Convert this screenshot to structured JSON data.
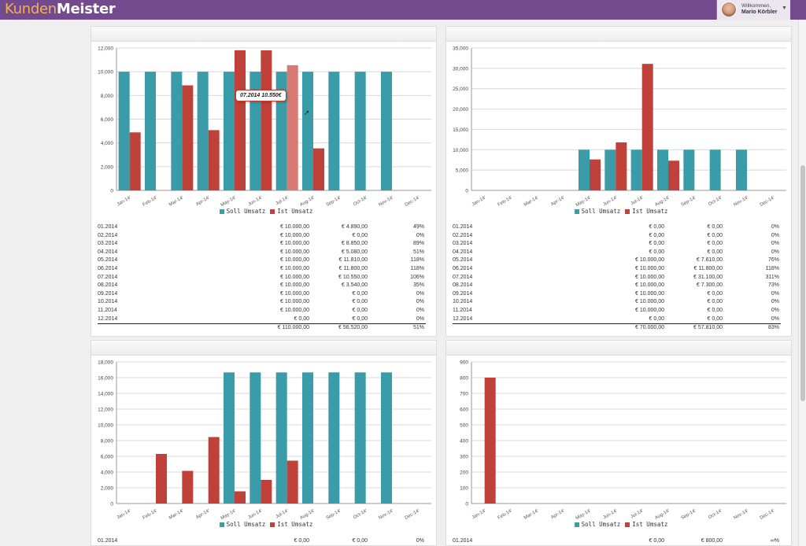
{
  "app": {
    "logo_part1": "Kunden",
    "logo_part2": "Meister"
  },
  "user": {
    "welcome": "Willkommen,",
    "name": "Mario Körbler"
  },
  "colors": {
    "soll": "#3a9ca8",
    "ist": "#c0403a",
    "ist_hover": "#d87a73",
    "topbar": "#744a8e"
  },
  "legend": {
    "soll": "Soll Umsatz",
    "ist": "Ist Umsatz"
  },
  "tooltip": {
    "text": "07.2014 10.550€"
  },
  "panels": [
    {
      "title": "",
      "chart_data": {
        "type": "bar",
        "categories": [
          "Jan-14'",
          "Feb-14'",
          "Mar-14'",
          "Apr-14'",
          "May-14'",
          "Jun-14'",
          "Jul-14'",
          "Aug-14'",
          "Sep-14'",
          "Oct-14'",
          "Nov-14'",
          "Dec-14'"
        ],
        "series": [
          {
            "name": "Soll Umsatz",
            "values": [
              10000,
              10000,
              10000,
              10000,
              10000,
              10000,
              10000,
              10000,
              10000,
              10000,
              10000,
              0
            ]
          },
          {
            "name": "Ist Umsatz",
            "values": [
              4890,
              0,
              8850,
              5080,
              11810,
              11800,
              10550,
              3540,
              0,
              0,
              0,
              0
            ]
          }
        ],
        "ylim": [
          0,
          12000
        ],
        "yticks": [
          "0",
          "2,000",
          "4,000",
          "6,000",
          "8,000",
          "10,000",
          "12,000"
        ],
        "hover_index": 6
      },
      "rows": [
        [
          "01.2014",
          "€ 10.000,00",
          "€ 4.890,00",
          "49%"
        ],
        [
          "02.2014",
          "€ 10.000,00",
          "€ 0,00",
          "0%"
        ],
        [
          "03.2014",
          "€ 10.000,00",
          "€ 8.850,00",
          "89%"
        ],
        [
          "04.2014",
          "€ 10.000,00",
          "€ 5.080,00",
          "51%"
        ],
        [
          "05.2014",
          "€ 10.000,00",
          "€ 11.810,00",
          "118%"
        ],
        [
          "06.2014",
          "€ 10.000,00",
          "€ 11.800,00",
          "118%"
        ],
        [
          "07.2014",
          "€ 10.000,00",
          "€ 10.550,00",
          "106%"
        ],
        [
          "08.2014",
          "€ 10.000,00",
          "€ 3.540,00",
          "35%"
        ],
        [
          "09.2014",
          "€ 10.000,00",
          "€ 0,00",
          "0%"
        ],
        [
          "10.2014",
          "€ 10.000,00",
          "€ 0,00",
          "0%"
        ],
        [
          "11.2014",
          "€ 10.000,00",
          "€ 0,00",
          "0%"
        ],
        [
          "12.2014",
          "€ 0,00",
          "€ 0,00",
          "0%"
        ]
      ],
      "total": [
        "",
        "€ 110.000,00",
        "€ 56.520,00",
        "51%"
      ]
    },
    {
      "title": "",
      "chart_data": {
        "type": "bar",
        "categories": [
          "Jan-14'",
          "Feb-14'",
          "Mar-14'",
          "Apr-14'",
          "May-14'",
          "Jun-14'",
          "Jul-14'",
          "Aug-14'",
          "Sep-14'",
          "Oct-14'",
          "Nov-14'",
          "Dec-14'"
        ],
        "series": [
          {
            "name": "Soll Umsatz",
            "values": [
              0,
              0,
              0,
              0,
              10000,
              10000,
              10000,
              10000,
              10000,
              10000,
              10000,
              0
            ]
          },
          {
            "name": "Ist Umsatz",
            "values": [
              0,
              0,
              0,
              0,
              7610,
              11800,
              31100,
              7300,
              0,
              0,
              0,
              0
            ]
          }
        ],
        "ylim": [
          0,
          35000
        ],
        "yticks": [
          "0",
          "5,000",
          "10,000",
          "15,000",
          "20,000",
          "25,000",
          "30,000",
          "35,000"
        ]
      },
      "rows": [
        [
          "01.2014",
          "€ 0,00",
          "€ 0,00",
          "0%"
        ],
        [
          "02.2014",
          "€ 0,00",
          "€ 0,00",
          "0%"
        ],
        [
          "03.2014",
          "€ 0,00",
          "€ 0,00",
          "0%"
        ],
        [
          "04.2014",
          "€ 0,00",
          "€ 0,00",
          "0%"
        ],
        [
          "05.2014",
          "€ 10.000,00",
          "€ 7.610,00",
          "76%"
        ],
        [
          "06.2014",
          "€ 10.000,00",
          "€ 11.800,00",
          "118%"
        ],
        [
          "07.2014",
          "€ 10.000,00",
          "€ 31.100,00",
          "311%"
        ],
        [
          "08.2014",
          "€ 10.000,00",
          "€ 7.300,00",
          "73%"
        ],
        [
          "09.2014",
          "€ 10.000,00",
          "€ 0,00",
          "0%"
        ],
        [
          "10.2014",
          "€ 10.000,00",
          "€ 0,00",
          "0%"
        ],
        [
          "11.2014",
          "€ 10.000,00",
          "€ 0,00",
          "0%"
        ],
        [
          "12.2014",
          "€ 0,00",
          "€ 0,00",
          "0%"
        ]
      ],
      "total": [
        "",
        "€ 70.000,00",
        "€ 57.810,00",
        "83%"
      ]
    },
    {
      "title": "",
      "chart_data": {
        "type": "bar",
        "categories": [
          "Jan-14'",
          "Feb-14'",
          "Mar-14'",
          "Apr-14'",
          "May-14'",
          "Jun-14'",
          "Jul-14'",
          "Aug-14'",
          "Sep-14'",
          "Oct-14'",
          "Nov-14'",
          "Dec-14'"
        ],
        "series": [
          {
            "name": "Soll Umsatz",
            "values": [
              0,
              0,
              0,
              0,
              16667,
              16667,
              16667,
              16667,
              16667,
              16667,
              16667,
              0
            ]
          },
          {
            "name": "Ist Umsatz",
            "values": [
              0,
              6300,
              4150,
              8450,
              1550,
              3000,
              5450,
              0,
              0,
              0,
              0,
              0
            ]
          }
        ],
        "ylim": [
          0,
          18000
        ],
        "yticks": [
          "0",
          "2,000",
          "4,000",
          "6,000",
          "8,000",
          "10,000",
          "12,000",
          "14,000",
          "16,000",
          "18,000"
        ]
      },
      "rows": [
        [
          "01.2014",
          "€ 0,00",
          "€ 0,00",
          "0%"
        ]
      ]
    },
    {
      "title": "",
      "chart_data": {
        "type": "bar",
        "categories": [
          "Jan-14'",
          "Feb-14'",
          "Mar-14'",
          "Apr-14'",
          "May-14'",
          "Jun-14'",
          "Jul-14'",
          "Aug-14'",
          "Sep-14'",
          "Oct-14'",
          "Nov-14'",
          "Dec-14'"
        ],
        "series": [
          {
            "name": "Soll Umsatz",
            "values": [
              0,
              0,
              0,
              0,
              0,
              0,
              0,
              0,
              0,
              0,
              0,
              0
            ]
          },
          {
            "name": "Ist Umsatz",
            "values": [
              800,
              0,
              0,
              0,
              0,
              0,
              0,
              0,
              0,
              0,
              0,
              0
            ]
          }
        ],
        "ylim": [
          0,
          900
        ],
        "yticks": [
          "0",
          "100",
          "200",
          "300",
          "400",
          "500",
          "600",
          "700",
          "800",
          "900"
        ]
      },
      "rows": [
        [
          "01.2014",
          "€ 0,00",
          "€ 800,00",
          "∞%"
        ]
      ]
    }
  ]
}
